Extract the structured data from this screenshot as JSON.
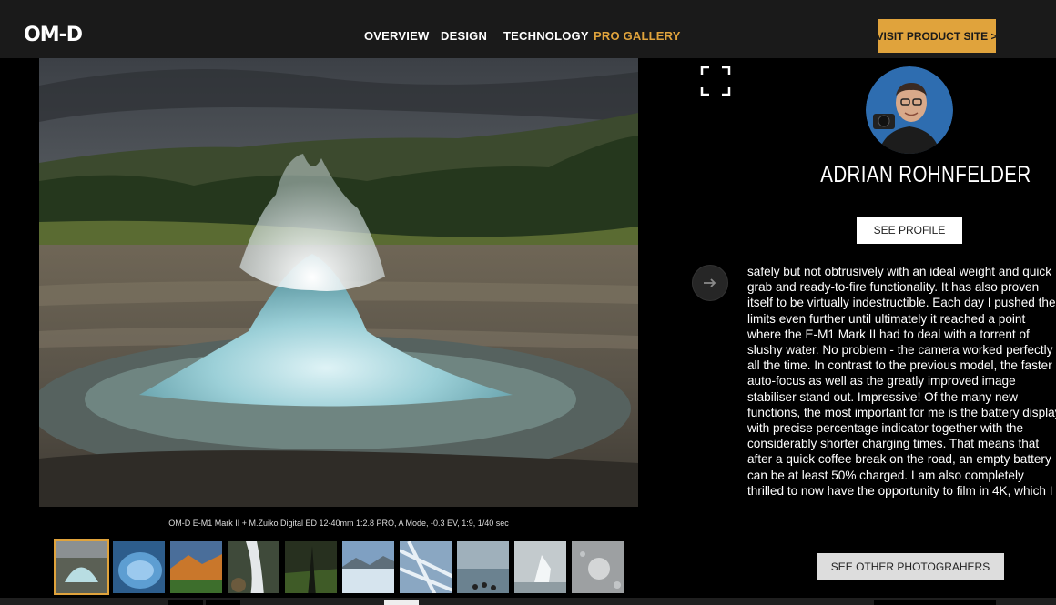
{
  "header": {
    "logo": "OM-D",
    "nav": [
      {
        "label": "OVERVIEW",
        "active": false
      },
      {
        "label": "DESIGN",
        "active": false
      },
      {
        "label": "TECHNOLOGY",
        "active": false
      },
      {
        "label": "PRO GALLERY",
        "active": true
      }
    ],
    "cta_label": "VISIT PRODUCT SITE >",
    "accent_color": "#e0a33c"
  },
  "gallery": {
    "main_photo_icon": "geyser-photo",
    "caption": "OM-D E-M1 Mark II + M.Zuiko Digital ED 12-40mm 1:2.8 PRO, A Mode, -0.3 EV, 1:9, 1/40 sec",
    "thumbnails_count": 10,
    "selected_thumbnail": 1
  },
  "photographer": {
    "name": "ADRIAN ROHNFELDER",
    "profile_button": "SEE PROFILE",
    "bio": "safely but not obtrusively with an ideal weight and quick grab and ready-to-fire functionality. It has also proven itself to be virtually indestructible. Each day I pushed the limits even further until ultimately it reached a point where the E-M1 Mark II had to deal with a torrent of slushy water. No problem - the camera worked perfectly all the time. In contrast to the previous model, the faster auto-focus as well as the greatly improved image stabiliser stand out. Impressive! Of the many new functions, the most important for me is the battery display with precise percentage indicator together with the considerably shorter charging times. That means that after a quick coffee break on the road, an empty battery can be at least 50% charged. I am also completely thrilled to now have the opportunity to film in 4K, which I",
    "others_button": "SEE OTHER PHOTOGRAHERS"
  },
  "icons": {
    "fullscreen": "fullscreen-icon",
    "next": "arrow-right-icon"
  }
}
